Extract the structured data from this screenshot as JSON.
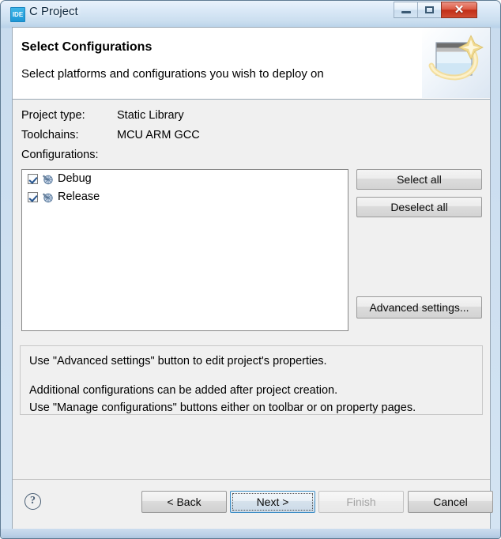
{
  "window": {
    "title": "C Project",
    "icon": "ide-icon",
    "icon_text": "IDE",
    "controls": {
      "minimize": "Minimize",
      "maximize": "Maximize",
      "close": "Close"
    }
  },
  "header": {
    "title": "Select Configurations",
    "subtitle": "Select platforms and configurations you wish to deploy on",
    "banner_icon": "wizard-window-sparkle-icon"
  },
  "fields": [
    {
      "label": "Project type:",
      "value": "Static Library"
    },
    {
      "label": "Toolchains:",
      "value": "MCU ARM GCC"
    },
    {
      "label": "Configurations:",
      "value": ""
    }
  ],
  "configurations": [
    {
      "label": "Debug",
      "checked": true,
      "icon": "configuration-icon"
    },
    {
      "label": "Release",
      "checked": true,
      "icon": "configuration-icon"
    }
  ],
  "side_buttons": {
    "select_all": "Select all",
    "deselect_all": "Deselect all",
    "advanced_settings": "Advanced settings..."
  },
  "info": {
    "line1": "Use \"Advanced settings\" button to edit project's properties.",
    "line2": "Additional configurations can be added after project creation.",
    "line3": "Use \"Manage configurations\" buttons either on toolbar or on property pages."
  },
  "footer": {
    "help": "?",
    "back": "< Back",
    "next": "Next >",
    "finish": "Finish",
    "cancel": "Cancel",
    "next_focused": true,
    "finish_disabled": true
  },
  "colors": {
    "accent_blue": "#3c8dc5",
    "close_red": "#c12e17",
    "title_icon_blue": "#1d97d6",
    "checkmark_blue": "#24538e",
    "dialog_bg": "#f0f0f0",
    "header_bg": "#ffffff"
  }
}
